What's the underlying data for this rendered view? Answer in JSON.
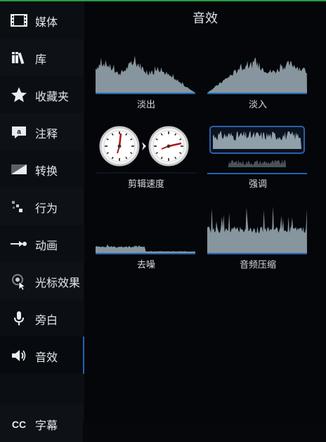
{
  "sidebar": {
    "items": [
      {
        "label": "媒体",
        "icon": "film-icon"
      },
      {
        "label": "库",
        "icon": "library-icon"
      },
      {
        "label": "收藏夹",
        "icon": "star-icon"
      },
      {
        "label": "注释",
        "icon": "annotation-icon"
      },
      {
        "label": "转换",
        "icon": "transition-icon"
      },
      {
        "label": "行为",
        "icon": "behavior-icon"
      },
      {
        "label": "动画",
        "icon": "animation-icon"
      },
      {
        "label": "光标效果",
        "icon": "cursor-effect-icon"
      },
      {
        "label": "旁白",
        "icon": "microphone-icon"
      },
      {
        "label": "音效",
        "icon": "speaker-icon"
      },
      {
        "label": "字幕",
        "icon": "captions-icon"
      }
    ],
    "active": "音效"
  },
  "main": {
    "title": "音效",
    "effects": [
      {
        "label": "淡出",
        "icon": "fade-out-waveform"
      },
      {
        "label": "淡入",
        "icon": "fade-in-waveform"
      },
      {
        "label": "剪辑速度",
        "icon": "clip-speed-clocks"
      },
      {
        "label": "强调",
        "icon": "emphasize-waveform"
      },
      {
        "label": "去噪",
        "icon": "noise-removal-waveform"
      },
      {
        "label": "音频压缩",
        "icon": "audio-compression-waveform"
      }
    ]
  },
  "colors": {
    "accent": "#1f63b3",
    "waveform": "#9fb0b8",
    "background": "#04060a",
    "sidebar": "#0b0e12"
  }
}
